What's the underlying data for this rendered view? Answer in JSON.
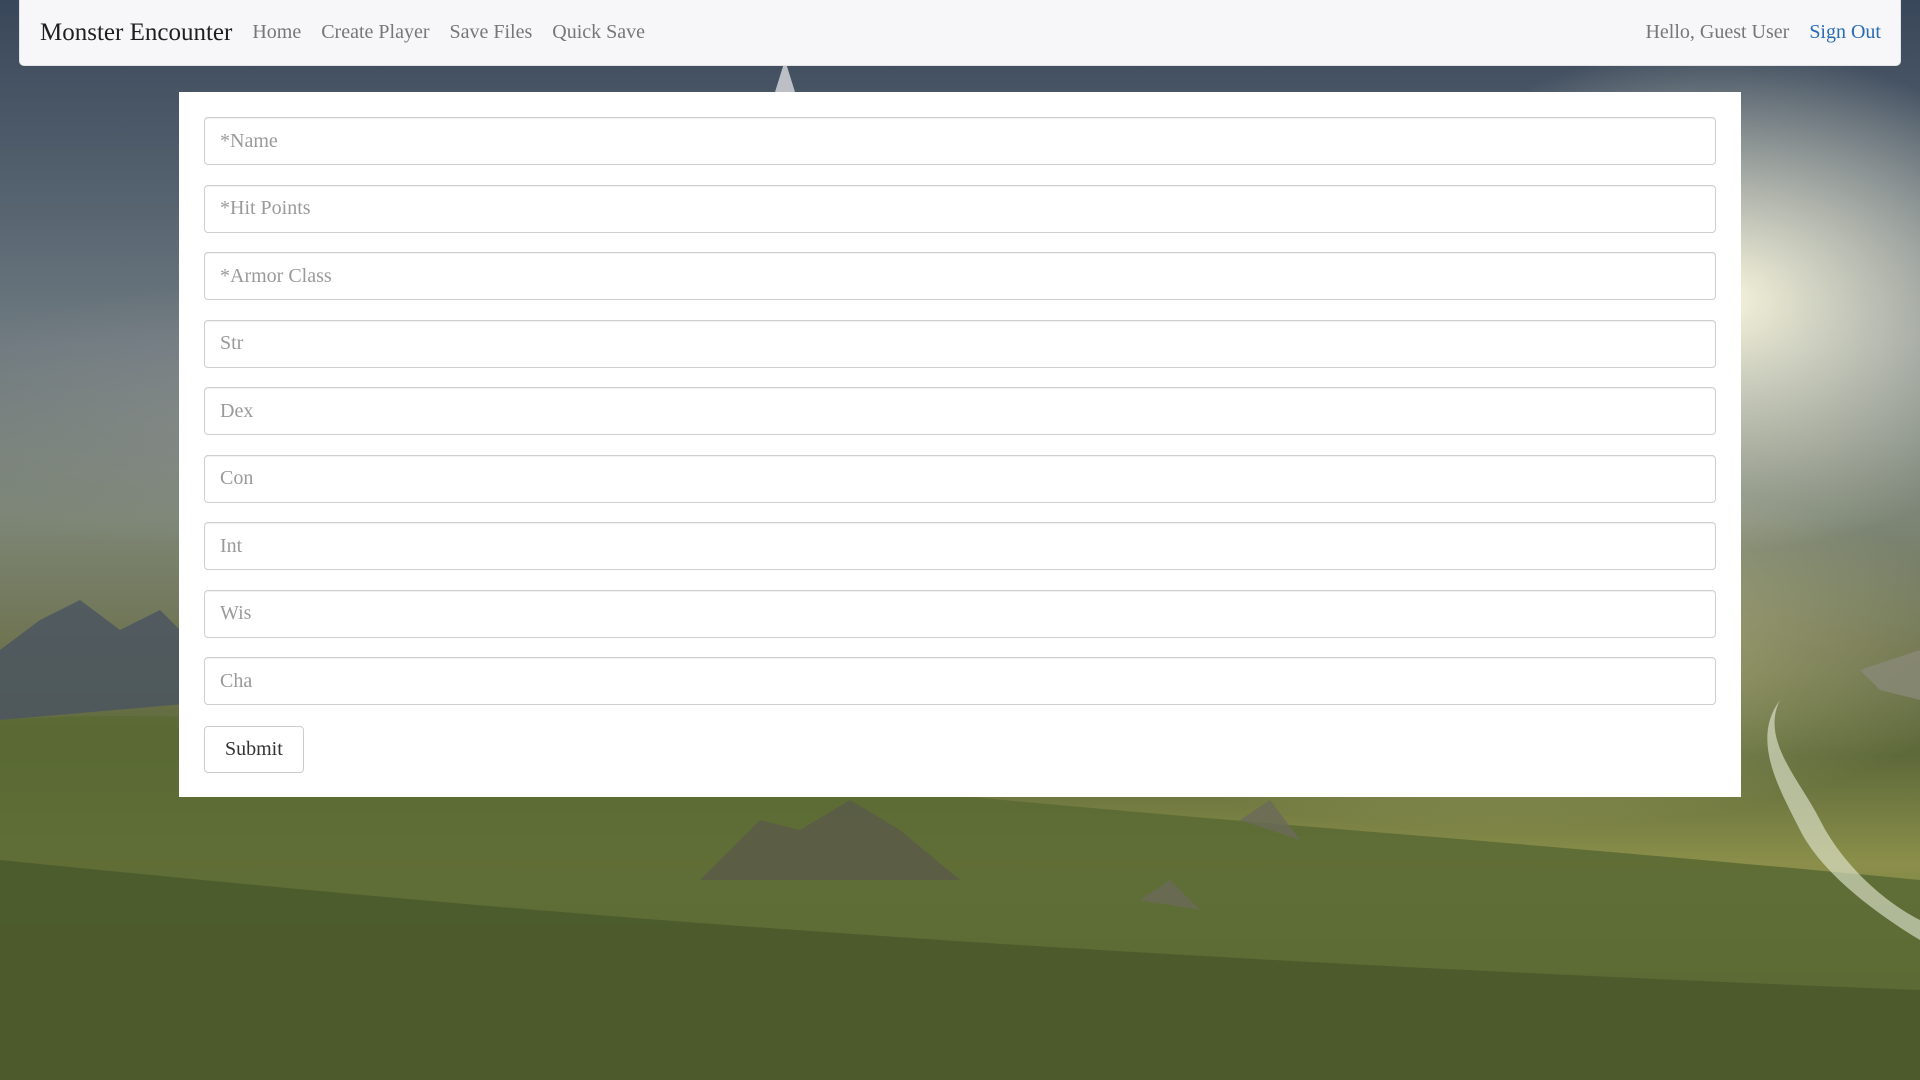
{
  "navbar": {
    "brand": "Monster Encounter",
    "links": [
      {
        "label": "Home"
      },
      {
        "label": "Create Player"
      },
      {
        "label": "Save Files"
      },
      {
        "label": "Quick Save"
      }
    ],
    "greeting": "Hello, Guest User",
    "sign_out": "Sign Out",
    "sign_out_color": "#2a6bb3"
  },
  "form": {
    "fields": [
      {
        "placeholder": "*Name",
        "value": ""
      },
      {
        "placeholder": "*Hit Points",
        "value": ""
      },
      {
        "placeholder": "*Armor Class",
        "value": ""
      },
      {
        "placeholder": "Str",
        "value": ""
      },
      {
        "placeholder": "Dex",
        "value": ""
      },
      {
        "placeholder": "Con",
        "value": ""
      },
      {
        "placeholder": "Int",
        "value": ""
      },
      {
        "placeholder": "Wis",
        "value": ""
      },
      {
        "placeholder": "Cha",
        "value": ""
      }
    ],
    "submit_label": "Submit"
  }
}
